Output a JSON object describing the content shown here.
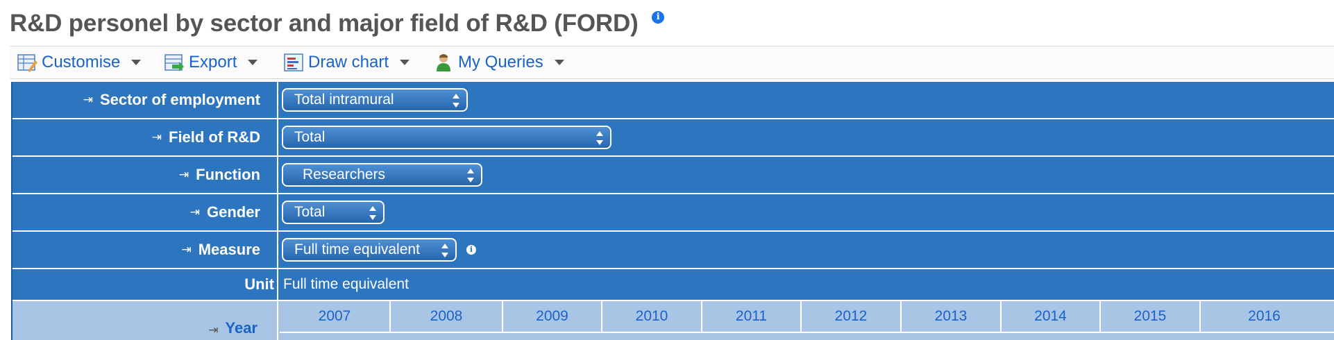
{
  "page": {
    "title": "R&D personel by sector and major field of R&D (FORD)",
    "info_icon": "info-icon",
    "accent_color": "#2e75bf",
    "link_color": "#1a63c6"
  },
  "toolbar": {
    "customise_label": "Customise",
    "export_label": "Export",
    "draw_chart_label": "Draw chart",
    "my_queries_label": "My Queries"
  },
  "dimensions": {
    "sector": {
      "label": "Sector of employment",
      "value": "Total intramural"
    },
    "field": {
      "label": "Field of R&D",
      "value": "Total"
    },
    "function": {
      "label": "Function",
      "value": "Researchers"
    },
    "gender": {
      "label": "Gender",
      "value": "Total"
    },
    "measure": {
      "label": "Measure",
      "value": "Full time equivalent"
    },
    "unit": {
      "label": "Unit",
      "value": "Full time equivalent"
    }
  },
  "year_axis": {
    "label": "Year",
    "years": [
      "2007",
      "2008",
      "2009",
      "2010",
      "2011",
      "2012",
      "2013",
      "2014",
      "2015",
      "2016"
    ]
  }
}
